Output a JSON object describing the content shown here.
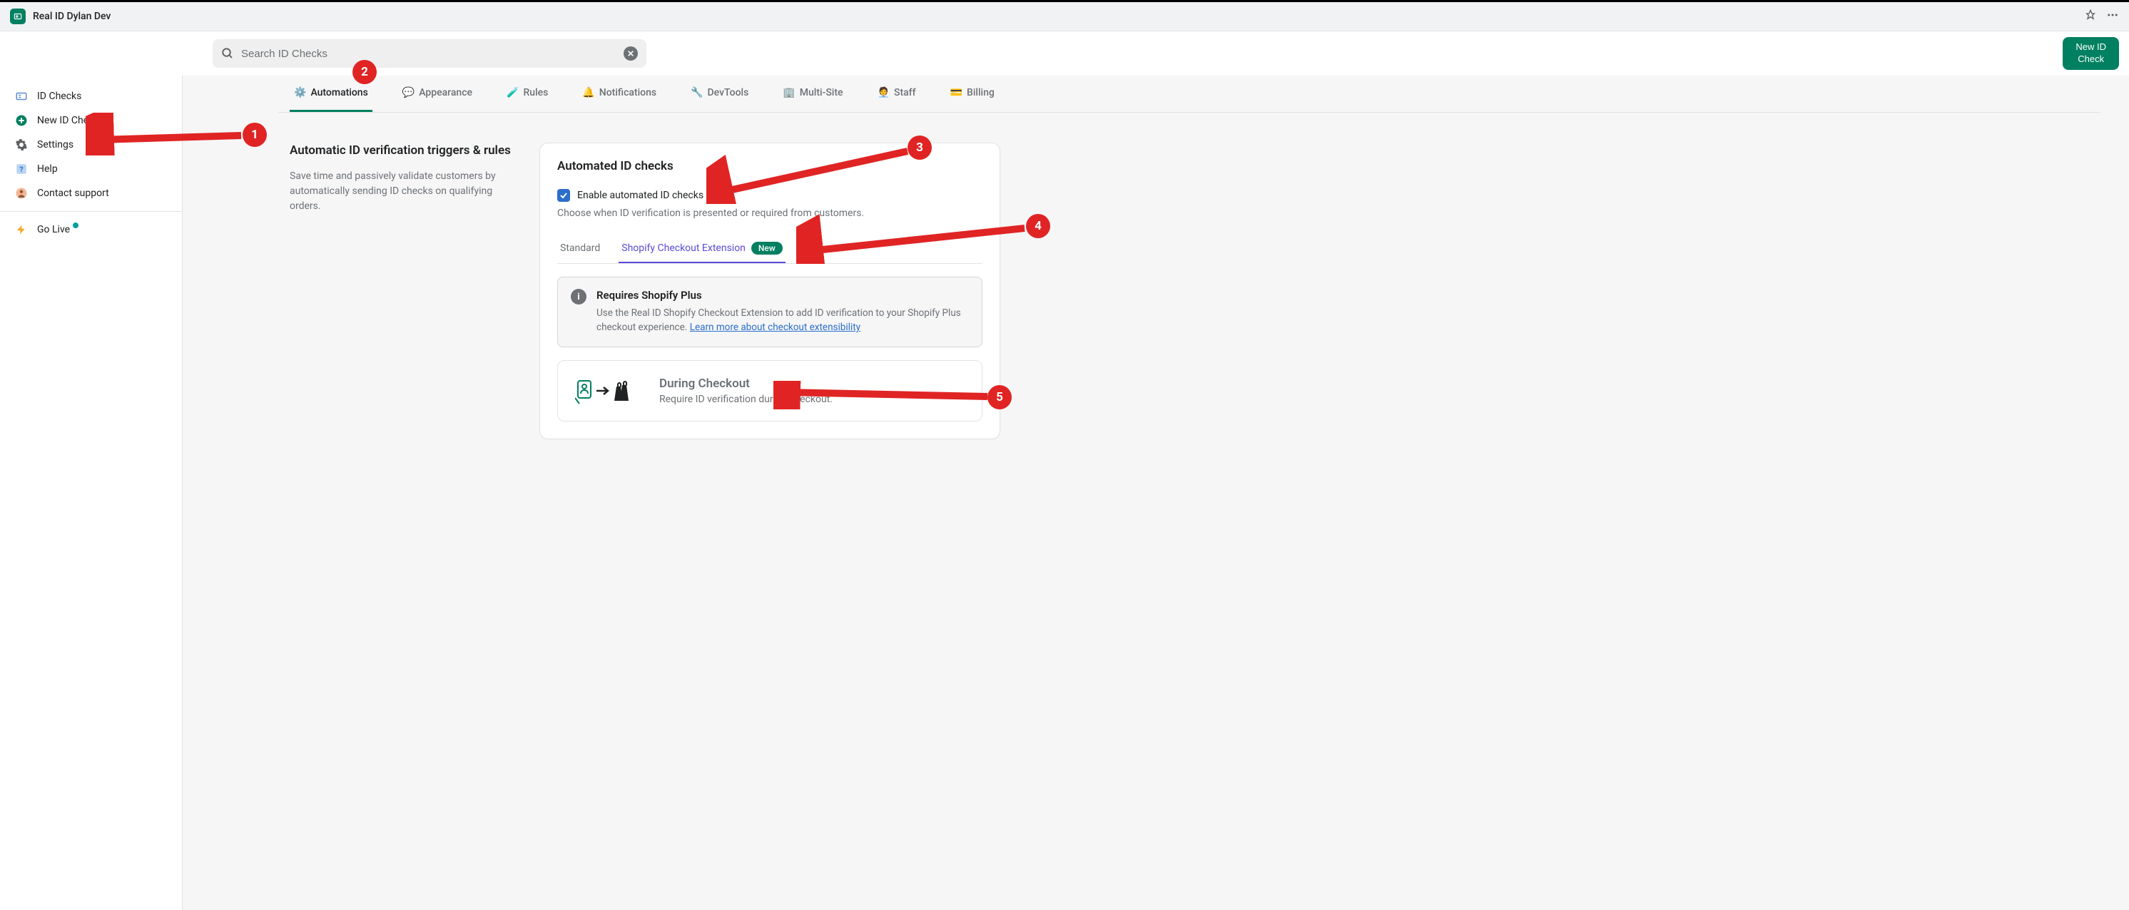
{
  "app": {
    "title": "Real ID Dylan Dev"
  },
  "toolbar": {
    "search_placeholder": "Search ID Checks",
    "new_id_label": "New ID\nCheck"
  },
  "sidebar": {
    "items": [
      {
        "icon": "id-checks-icon",
        "label": "ID Checks"
      },
      {
        "icon": "plus-circle-icon",
        "label": "New ID Check"
      },
      {
        "icon": "gear-icon",
        "label": "Settings"
      },
      {
        "icon": "question-icon",
        "label": "Help"
      },
      {
        "icon": "person-icon",
        "label": "Contact support"
      }
    ],
    "go_live_label": "Go Live"
  },
  "tabs": [
    {
      "icon": "⚙️",
      "label": "Automations",
      "active": true
    },
    {
      "icon": "💬",
      "label": "Appearance"
    },
    {
      "icon": "🔽",
      "label": "Rules"
    },
    {
      "icon": "🔔",
      "label": "Notifications"
    },
    {
      "icon": "🛠",
      "label": "DevTools"
    },
    {
      "icon": "🏢",
      "label": "Multi-Site"
    },
    {
      "icon": "👤",
      "label": "Staff"
    },
    {
      "icon": "💳",
      "label": "Billing"
    }
  ],
  "intro": {
    "heading": "Automatic ID verification triggers & rules",
    "body": "Save time and passively validate customers by automatically sending ID checks on qualifying orders."
  },
  "card": {
    "heading": "Automated ID checks",
    "checkbox_label": "Enable automated ID checks",
    "checkbox_checked": true,
    "checkbox_desc": "Choose when ID verification is presented or required from customers.",
    "subtabs": [
      {
        "label": "Standard",
        "active": false
      },
      {
        "label": "Shopify Checkout Extension",
        "active": true,
        "badge": "New"
      }
    ],
    "info": {
      "heading": "Requires Shopify Plus",
      "body": "Use the Real ID Shopify Checkout Extension to add ID verification to your Shopify Plus checkout experience.",
      "link_text": "Learn more about checkout extensibility"
    },
    "option": {
      "heading": "During Checkout",
      "body": "Require ID verification during checkout."
    }
  },
  "annotations": {
    "1": "1",
    "2": "2",
    "3": "3",
    "4": "4",
    "5": "5"
  }
}
